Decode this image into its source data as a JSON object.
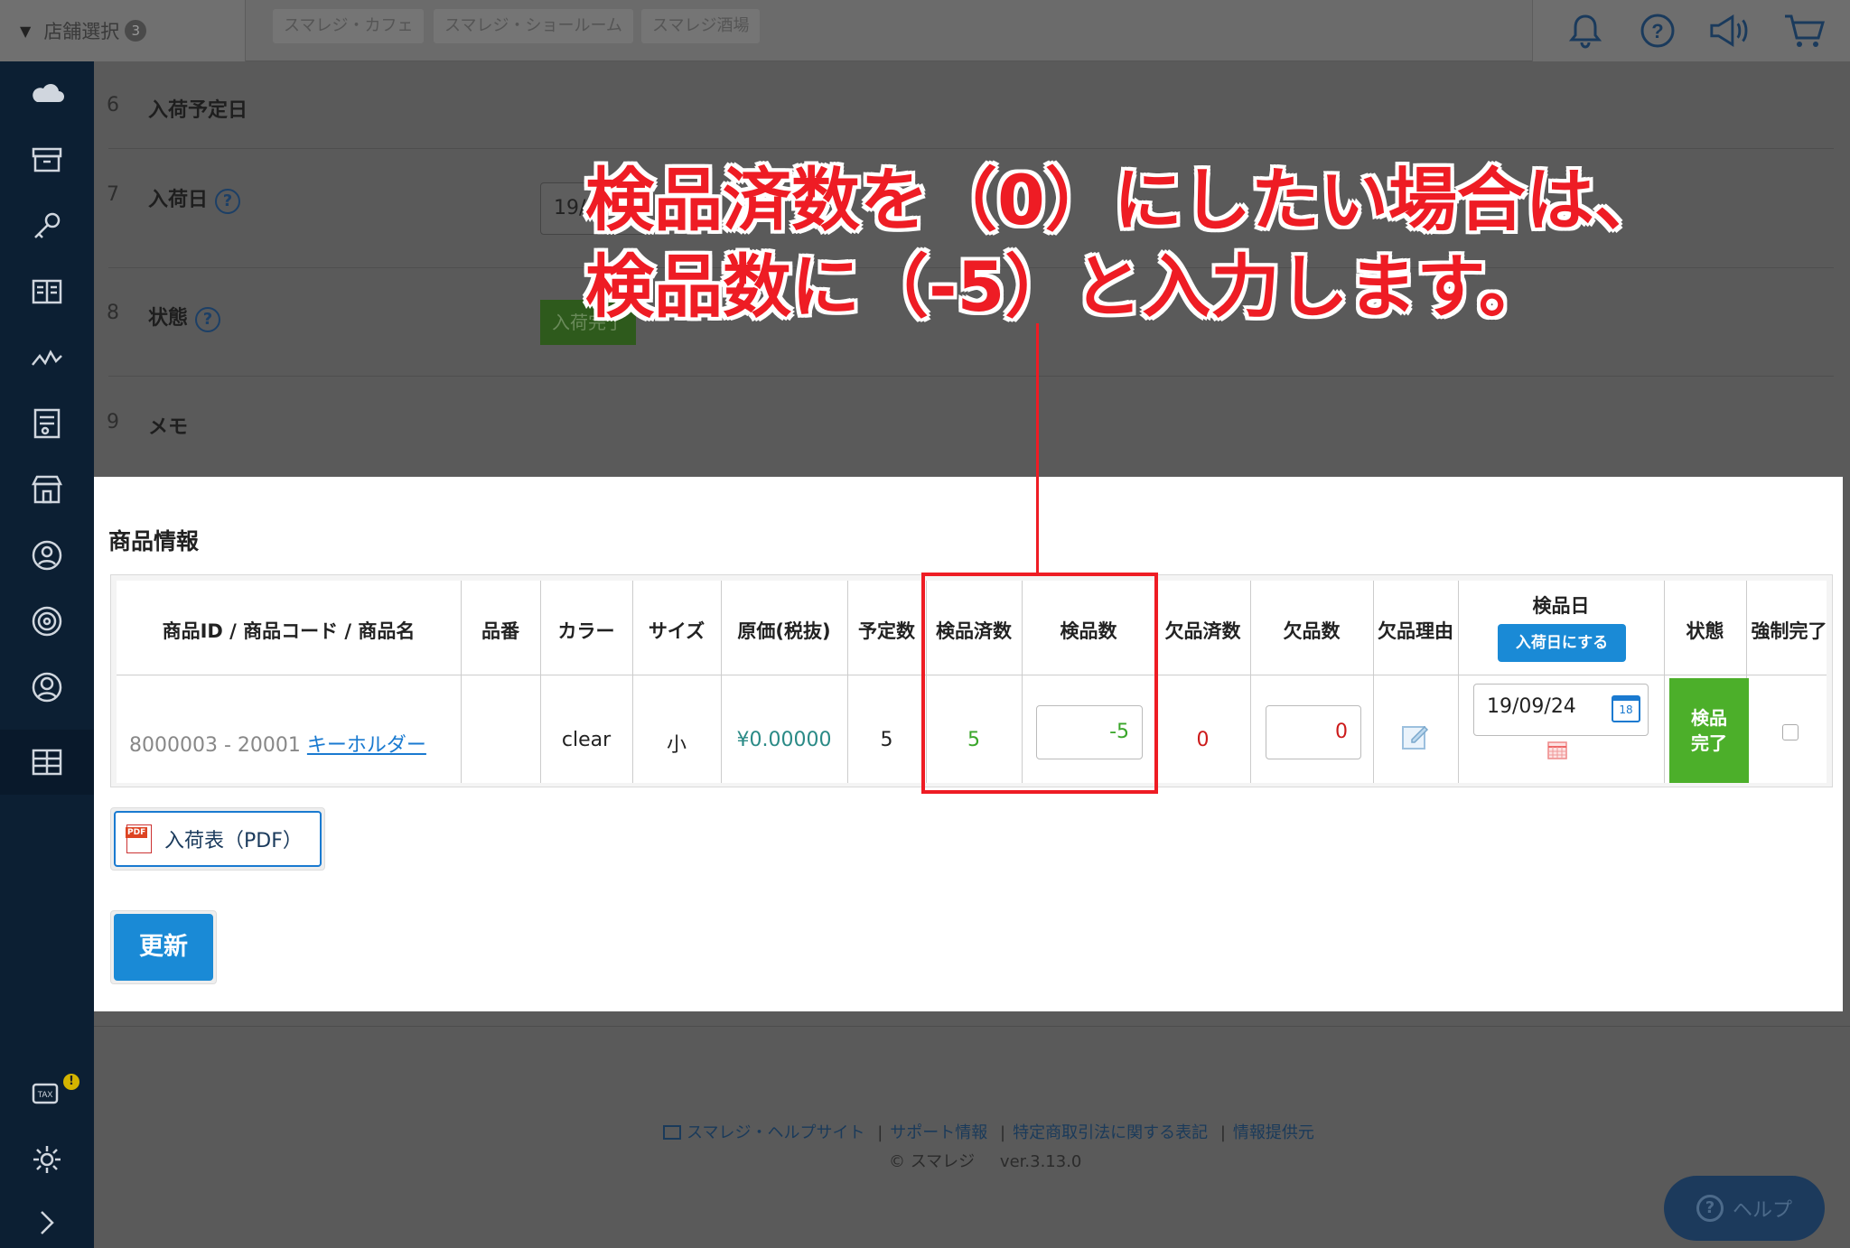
{
  "topbar": {
    "store_select_label": "店舗選択",
    "store_count": "3",
    "store_tabs": [
      "スマレジ・カフェ",
      "スマレジ・ショールーム",
      "スマレジ酒場"
    ],
    "icons": [
      "bell-icon",
      "question-icon",
      "megaphone-icon",
      "cart-icon"
    ]
  },
  "sidebar": {
    "icons": [
      "cloud-icon",
      "archive-icon",
      "key-icon",
      "book-icon",
      "chart-icon",
      "report-icon",
      "store-icon",
      "user-circle-icon",
      "target-icon",
      "account-icon",
      "grid-icon"
    ],
    "bottom_icons": [
      "tax-icon",
      "gear-icon",
      "chevron-right-icon"
    ],
    "tax_alert": "!"
  },
  "form_rows": [
    {
      "num": "6",
      "label": "入荷予定日"
    },
    {
      "num": "7",
      "label": "入荷日"
    },
    {
      "num": "8",
      "label": "状態"
    },
    {
      "num": "9",
      "label": "メモ"
    }
  ],
  "form_values": {
    "arrival_date_partial": "19/",
    "status_partial": "入荷完了"
  },
  "annotation": {
    "line1": "検品済数を（0）にしたい場合は、",
    "line2": "検品数に（-5）と入力します。"
  },
  "product_info": {
    "title": "商品情報",
    "headers": {
      "product": "商品ID / 商品コード / 商品名",
      "part_no": "品番",
      "color": "カラー",
      "size": "サイズ",
      "cost": "原価(税抜)",
      "planned": "予定数",
      "inspected_done": "検品済数",
      "inspect_count": "検品数",
      "missing_done": "欠品済数",
      "missing_count": "欠品数",
      "missing_reason": "欠品理由",
      "inspect_date": "検品日",
      "set_arrival_date_button": "入荷日にする",
      "status": "状態",
      "force_complete": "強制完了"
    },
    "row": {
      "product_id_code": "8000003 - 20001",
      "product_name": "キーホルダー",
      "part_no": "",
      "color": "clear",
      "size": "小",
      "cost": "¥0.00000",
      "planned": "5",
      "inspected_done": "5",
      "inspect_count": "-5",
      "missing_done": "0",
      "missing_count": "0",
      "inspect_date": "19/09/24",
      "calendar_day": "18",
      "status_line1": "検品",
      "status_line2": "完了",
      "force_complete_checked": false
    },
    "pdf_button": "入荷表（PDF）",
    "pdf_badge": "PDF",
    "update_button": "更新"
  },
  "footer": {
    "links": [
      "スマレジ・ヘルプサイト",
      "サポート情報",
      "特定商取引法に関する表記",
      "情報提供元"
    ],
    "separator": "|",
    "copyright": "© スマレジ",
    "version": "ver.3.13.0"
  },
  "help_button": "ヘルプ",
  "colors": {
    "accent": "#1a8ad6",
    "annotation": "#ee1c24",
    "green": "#4caf2a",
    "sidebar": "#0c1f33"
  }
}
